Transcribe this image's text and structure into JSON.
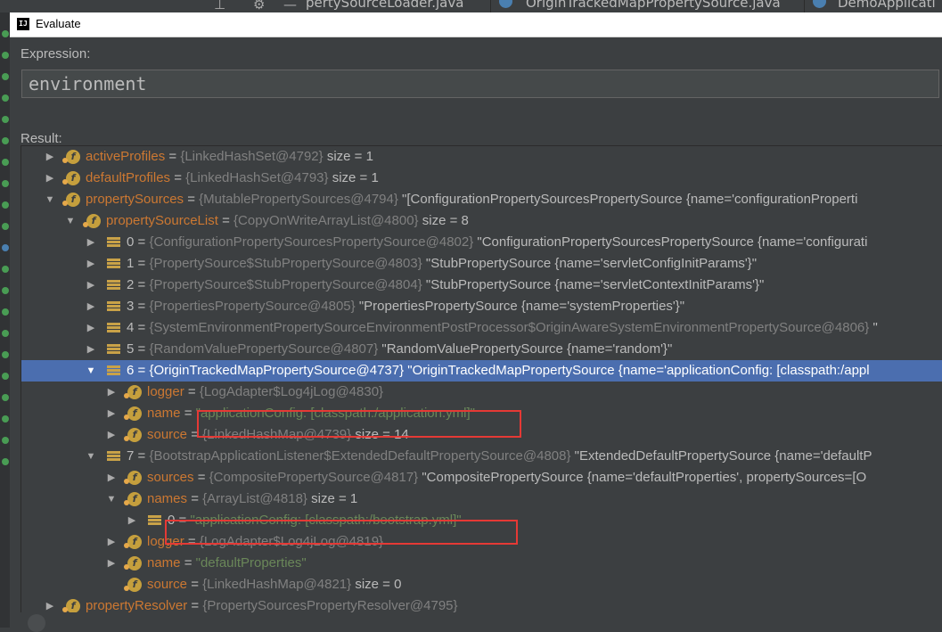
{
  "background_tabs": [
    {
      "label": "pertySourceLoader.java"
    },
    {
      "label": "OriginTrackedMapPropertySource.java"
    },
    {
      "label": "DemoApplicati"
    }
  ],
  "dialog": {
    "title": "Evaluate",
    "logo_text": "IJ",
    "expression_label": "Expression:",
    "expression_value": "environment",
    "result_label": "Result:"
  },
  "tree": {
    "rows": [
      {
        "name": "activeProfiles",
        "eq": " = ",
        "ref": "{LinkedHashSet@4792}",
        "extra": "  size = 1"
      },
      {
        "name": "defaultProfiles",
        "eq": " = ",
        "ref": "{LinkedHashSet@4793}",
        "extra": "  size = 1"
      },
      {
        "name": "propertySources",
        "eq": " = ",
        "ref": "{MutablePropertySources@4794}",
        "extra": " \"[ConfigurationPropertySourcesPropertySource {name='configurationProperti"
      },
      {
        "name": "propertySourceList",
        "eq": " = ",
        "ref": "{CopyOnWriteArrayList@4800}",
        "extra": "  size = 8"
      },
      {
        "name": "0",
        "eq": " = ",
        "ref": "{ConfigurationPropertySourcesPropertySource@4802}",
        "extra": " \"ConfigurationPropertySourcesPropertySource {name='configurati"
      },
      {
        "name": "1",
        "eq": " = ",
        "ref": "{PropertySource$StubPropertySource@4803}",
        "extra": " \"StubPropertySource {name='servletConfigInitParams'}\""
      },
      {
        "name": "2",
        "eq": " = ",
        "ref": "{PropertySource$StubPropertySource@4804}",
        "extra": " \"StubPropertySource {name='servletContextInitParams'}\""
      },
      {
        "name": "3",
        "eq": " = ",
        "ref": "{PropertiesPropertySource@4805}",
        "extra": " \"PropertiesPropertySource {name='systemProperties'}\""
      },
      {
        "name": "4",
        "eq": " = ",
        "ref": "{SystemEnvironmentPropertySourceEnvironmentPostProcessor$OriginAwareSystemEnvironmentPropertySource@4806}",
        "extra": " \""
      },
      {
        "name": "5",
        "eq": " = ",
        "ref": "{RandomValuePropertySource@4807}",
        "extra": " \"RandomValuePropertySource {name='random'}\""
      },
      {
        "name": "6",
        "eq": " = ",
        "ref": "{OriginTrackedMapPropertySource@4737}",
        "extra": " \"OriginTrackedMapPropertySource {name='applicationConfig: [classpath:/appl"
      },
      {
        "name": "logger",
        "eq": " = ",
        "ref": "{LogAdapter$Log4jLog@4830}",
        "extra": ""
      },
      {
        "name": "name",
        "eq": " = ",
        "str": "\"applicationConfig: [classpath:/application.yml]\""
      },
      {
        "name": "source",
        "eq": " = ",
        "ref": "{LinkedHashMap@4739}",
        "extra": "  size = 14"
      },
      {
        "name": "7",
        "eq": " = ",
        "ref": "{BootstrapApplicationListener$ExtendedDefaultPropertySource@4808}",
        "extra": " \"ExtendedDefaultPropertySource {name='defaultP"
      },
      {
        "name": "sources",
        "eq": " = ",
        "ref": "{CompositePropertySource@4817}",
        "extra": " \"CompositePropertySource {name='defaultProperties', propertySources=[O"
      },
      {
        "name": "names",
        "eq": " = ",
        "ref": "{ArrayList@4818}",
        "extra": "  size = 1"
      },
      {
        "name": "0",
        "eq": " = ",
        "str": "\"applicationConfig: [classpath:/bootstrap.yml]\""
      },
      {
        "name": "logger",
        "eq": " = ",
        "ref": "{LogAdapter$Log4jLog@4819}",
        "extra": ""
      },
      {
        "name": "name",
        "eq": " = ",
        "str": "\"defaultProperties\""
      },
      {
        "name": "source",
        "eq": " = ",
        "ref": "{LinkedHashMap@4821}",
        "extra": "  size = 0"
      },
      {
        "name": "propertyResolver",
        "eq": " = ",
        "ref": "{PropertySourcesPropertyResolver@4795}",
        "extra": ""
      }
    ]
  },
  "colors": {
    "selection": "#4b6eaf",
    "highlight_box": "#e53935",
    "string_value": "#6a8759",
    "field_name": "#cc7832"
  }
}
